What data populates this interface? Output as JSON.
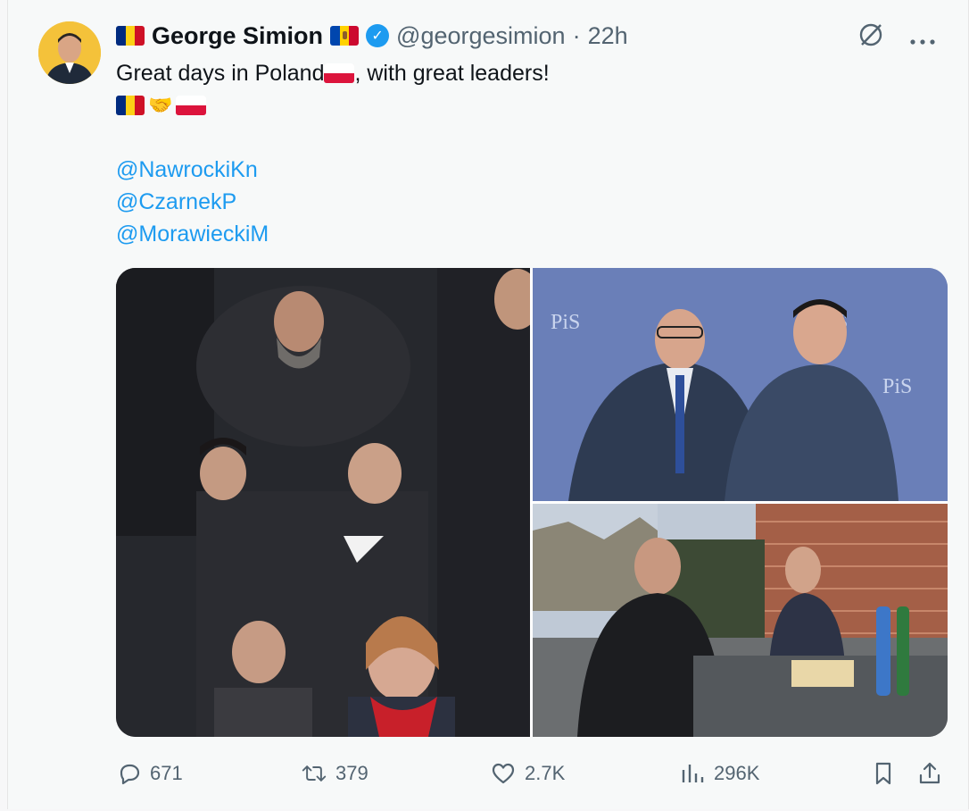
{
  "author": {
    "name": "George Simion",
    "handle": "@georgesimion",
    "separator": "·",
    "time": "22h"
  },
  "tweet": {
    "line1_prefix": "Great days in Poland",
    "line1_suffix": ", with great leaders!",
    "mentions": [
      "@NawrockiKn",
      "@CzarnekP",
      "@MorawieckiM"
    ]
  },
  "photos": {
    "photo2_logo": "PiS"
  },
  "icons": {
    "verified": "verified-badge-icon",
    "grok": "grok-icon",
    "more": "more-icon",
    "reply": "reply-icon",
    "retweet": "retweet-icon",
    "like": "like-icon",
    "views": "views-icon",
    "bookmark": "bookmark-icon",
    "share": "share-icon"
  },
  "actions": {
    "replies": "671",
    "retweets": "379",
    "likes": "2.7K",
    "views": "296K"
  },
  "colors": {
    "accent": "#1d9bf0",
    "muted": "#536471",
    "romania_blue": "#002b7f",
    "romania_yellow": "#fcd116",
    "romania_red": "#ce1126",
    "poland_red": "#dc143c"
  }
}
